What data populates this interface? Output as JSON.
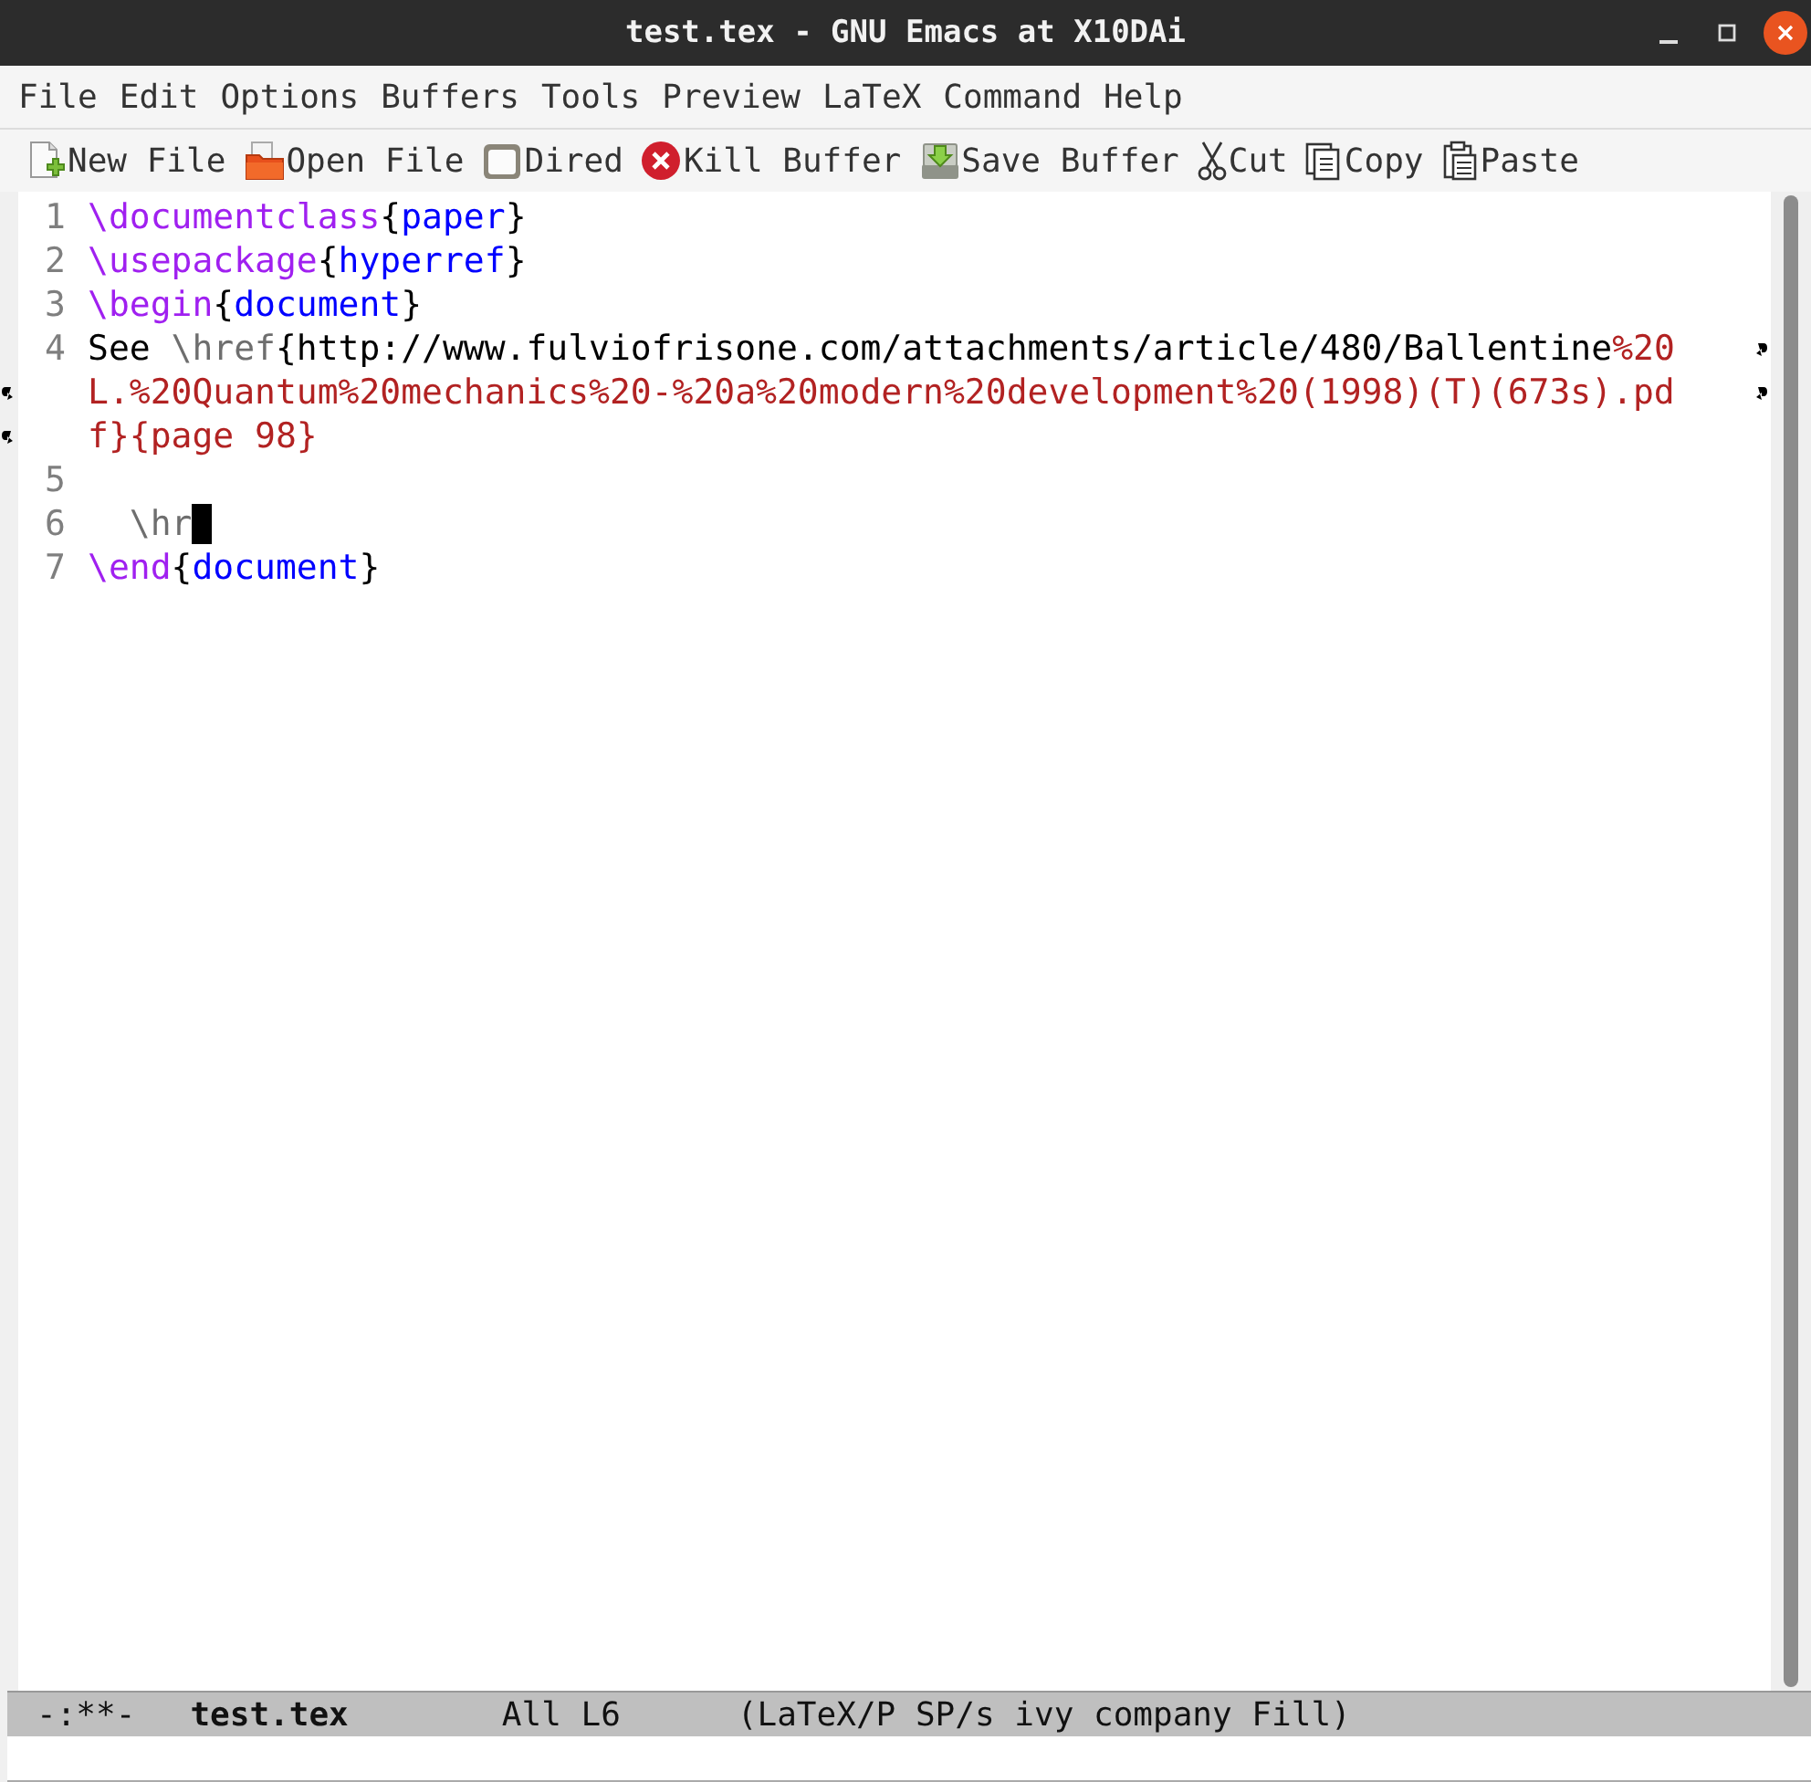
{
  "window": {
    "title": "test.tex - GNU Emacs at X10DAi",
    "controls": [
      {
        "kind": "minimize"
      },
      {
        "kind": "maximize"
      },
      {
        "kind": "close"
      }
    ]
  },
  "menu": [
    "File",
    "Edit",
    "Options",
    "Buffers",
    "Tools",
    "Preview",
    "LaTeX",
    "Command",
    "Help"
  ],
  "toolbar": [
    {
      "kind": "new",
      "label": "New File"
    },
    {
      "kind": "open",
      "label": "Open File"
    },
    {
      "kind": "dired",
      "label": "Dired"
    },
    {
      "kind": "kill",
      "label": "Kill Buffer"
    },
    {
      "kind": "save",
      "label": "Save Buffer"
    },
    {
      "kind": "cut",
      "label": "Cut"
    },
    {
      "kind": "copy",
      "label": "Copy"
    },
    {
      "kind": "paste",
      "label": "Paste"
    }
  ],
  "lines": [
    {
      "number": "1",
      "cursor": false,
      "rows": [
        [
          {
            "kind": "command",
            "text": "\\documentclass"
          },
          {
            "kind": "plain",
            "text": "{"
          },
          {
            "kind": "arg",
            "text": "paper"
          },
          {
            "kind": "plain",
            "text": "}"
          }
        ]
      ]
    },
    {
      "number": "2",
      "cursor": false,
      "rows": [
        [
          {
            "kind": "command",
            "text": "\\usepackage"
          },
          {
            "kind": "plain",
            "text": "{"
          },
          {
            "kind": "arg",
            "text": "hyperref"
          },
          {
            "kind": "plain",
            "text": "}"
          }
        ]
      ]
    },
    {
      "number": "3",
      "cursor": false,
      "rows": [
        [
          {
            "kind": "command",
            "text": "\\begin"
          },
          {
            "kind": "plain",
            "text": "{"
          },
          {
            "kind": "arg",
            "text": "document"
          },
          {
            "kind": "plain",
            "text": "}"
          }
        ]
      ]
    },
    {
      "number": "4",
      "cursor": false,
      "rows": [
        [
          {
            "kind": "plain",
            "text": "See "
          },
          {
            "kind": "dim",
            "text": "\\href"
          },
          {
            "kind": "plain",
            "text": "{http://www.fulviofrisone.com/attachments/article/480/Ballentine"
          },
          {
            "kind": "string",
            "text": "%20"
          }
        ],
        [
          {
            "kind": "string",
            "text": "L.%20Quantum%20mechanics%20-%20a%20modern%20development%20(1998)(T)(673s).pd"
          }
        ],
        [
          {
            "kind": "string",
            "text": "f}{page 98}"
          }
        ]
      ]
    },
    {
      "number": "5",
      "cursor": false,
      "rows": [
        []
      ]
    },
    {
      "number": "6",
      "cursor": true,
      "rows": [
        [
          {
            "kind": "dim",
            "text": "  \\hr"
          }
        ]
      ]
    },
    {
      "number": "7",
      "cursor": false,
      "rows": [
        [
          {
            "kind": "command",
            "text": "\\end"
          },
          {
            "kind": "plain",
            "text": "{"
          },
          {
            "kind": "arg",
            "text": "document"
          },
          {
            "kind": "plain",
            "text": "}"
          }
        ]
      ]
    }
  ],
  "mode_line": {
    "status": "-:**-",
    "buffer": "test.tex",
    "position": "All L6",
    "modes": "(LaTeX/P SP/s ivy company Fill)"
  }
}
